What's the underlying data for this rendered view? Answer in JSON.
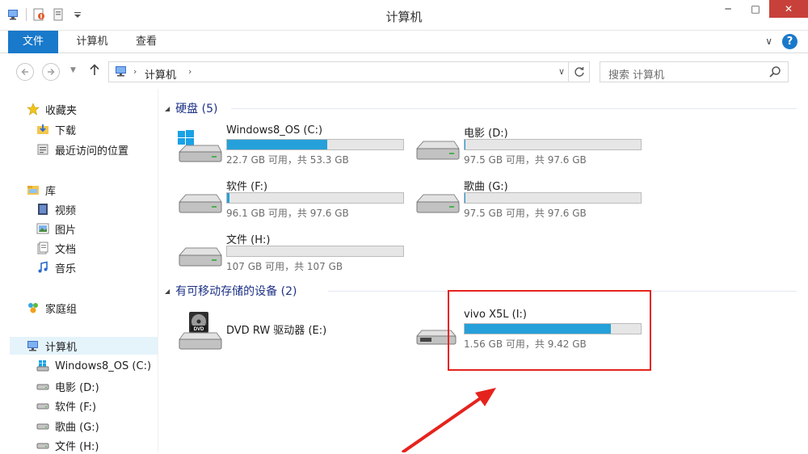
{
  "window": {
    "title": "计算机",
    "minimize_glyph": "─",
    "maximize_glyph": "□",
    "close_glyph": "✕"
  },
  "ribbon": {
    "tabs": [
      {
        "label": "文件"
      },
      {
        "label": "计算机"
      },
      {
        "label": "查看"
      }
    ],
    "expand_glyph": "∨",
    "help_glyph": "?"
  },
  "address": {
    "crumb": "计算机",
    "search_placeholder": "搜索 计算机"
  },
  "sidebar": {
    "favorites": {
      "label": "收藏夹",
      "items": [
        {
          "label": "下载"
        },
        {
          "label": "最近访问的位置"
        }
      ]
    },
    "libraries": {
      "label": "库",
      "items": [
        {
          "label": "视频"
        },
        {
          "label": "图片"
        },
        {
          "label": "文档"
        },
        {
          "label": "音乐"
        }
      ]
    },
    "homegroup": {
      "label": "家庭组"
    },
    "computer": {
      "label": "计算机",
      "items": [
        {
          "label": "Windows8_OS (C:)"
        },
        {
          "label": "电影 (D:)"
        },
        {
          "label": "软件 (F:)"
        },
        {
          "label": "歌曲 (G:)"
        },
        {
          "label": "文件 (H:)"
        }
      ]
    }
  },
  "groups": {
    "disks": {
      "title": "硬盘 (5)"
    },
    "removable": {
      "title": "有可移动存储的设备 (2)"
    }
  },
  "drives": {
    "c": {
      "name": "Windows8_OS (C:)",
      "info": "22.7 GB 可用，共 53.3 GB",
      "used_fraction": 0.57,
      "bar_color": "#26a0da"
    },
    "d": {
      "name": "电影 (D:)",
      "info": "97.5 GB 可用，共 97.6 GB",
      "used_fraction": 0.001
    },
    "f": {
      "name": "软件 (F:)",
      "info": "96.1 GB 可用，共 97.6 GB",
      "used_fraction": 0.015
    },
    "g": {
      "name": "歌曲 (G:)",
      "info": "97.5 GB 可用，共 97.6 GB",
      "used_fraction": 0.001
    },
    "h": {
      "name": "文件 (H:)",
      "info": "107 GB 可用，共 107 GB",
      "used_fraction": 0.0
    },
    "e": {
      "name": "DVD RW 驱动器 (E:)",
      "icon_text": "DVD"
    },
    "i": {
      "name": "vivo X5L (I:)",
      "info": "1.56 GB 可用，共 9.42 GB",
      "used_fraction": 0.83
    }
  },
  "annotation": {
    "highlight_color": "#e5231d"
  }
}
